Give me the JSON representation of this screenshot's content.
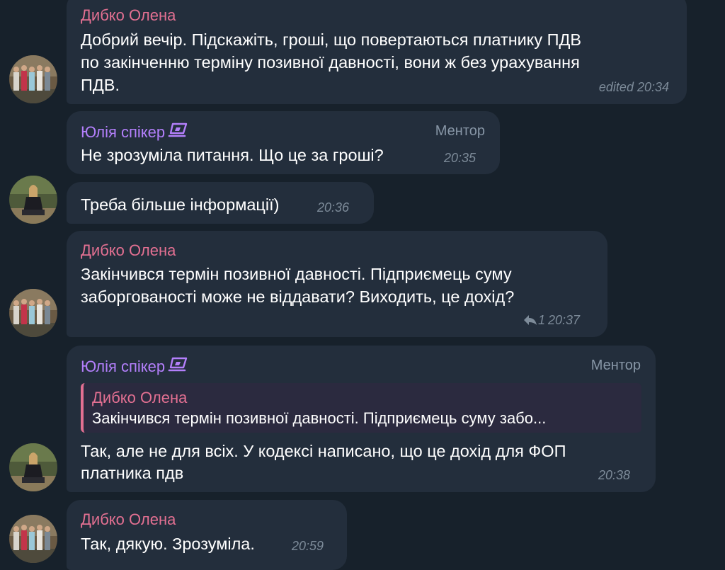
{
  "messages": [
    {
      "sender": "Дибко Олена",
      "lines": [
        "Добрий вечір. Підскажіть, гроші, що повертаються платнику  ПДВ",
        "по закінченню терміну позивної давності, вони ж без урахування",
        "ПДВ."
      ],
      "time": "edited 20:34"
    },
    {
      "sender": "Юлія спікер",
      "role": "Ментор",
      "lines": [
        "Не зрозуміла питання. Що це за гроші?"
      ],
      "time": "20:35"
    },
    {
      "lines": [
        "Треба більше інформації)"
      ],
      "time": "20:36"
    },
    {
      "sender": "Дибко Олена",
      "lines": [
        "Закінчився термін позивної давності.  Підприємець суму",
        "заборгованості може не віддавати? Виходить, це дохід?"
      ],
      "replies": "1",
      "time": "20:37"
    },
    {
      "sender": "Юлія спікер",
      "role": "Ментор",
      "quote": {
        "sender": "Дибко Олена",
        "text": "Закінчився термін позивної давності.  Підприємець суму забо..."
      },
      "lines": [
        "Так, але не для всіх. У кодексі написано, що це дохід для ФОП",
        "платника пдв"
      ],
      "time": "20:38"
    },
    {
      "sender": "Дибко Олена",
      "lines": [
        "Так, дякую. Зрозуміла."
      ],
      "time": "20:59"
    }
  ],
  "icons": {
    "reply": "reply-arrow-icon",
    "laptop": "laptop-icon"
  },
  "colors": {
    "background": "#17212b",
    "bubble": "#232e3c",
    "sender_pink": "#e37092",
    "sender_purple": "#b37ffb",
    "meta": "#7d8b99"
  }
}
